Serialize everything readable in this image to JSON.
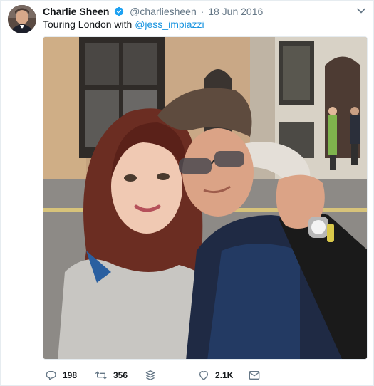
{
  "tweet": {
    "author_name": "Charlie Sheen",
    "handle": "@charliesheen",
    "separator": "·",
    "date": "18 Jun 2016",
    "text_prefix": "Touring London with ",
    "mention": "@jess_impiazzi",
    "verified": true
  },
  "actions": {
    "replies": "198",
    "retweets": "356",
    "likes": "2.1K"
  },
  "colors": {
    "accent": "#1b95e0",
    "muted": "#657786",
    "text": "#14171a"
  },
  "icons": [
    "avatar",
    "verified-badge-icon",
    "chevron-down-icon",
    "reply-icon",
    "retweet-icon",
    "stack-icon",
    "heart-icon",
    "message-icon"
  ]
}
